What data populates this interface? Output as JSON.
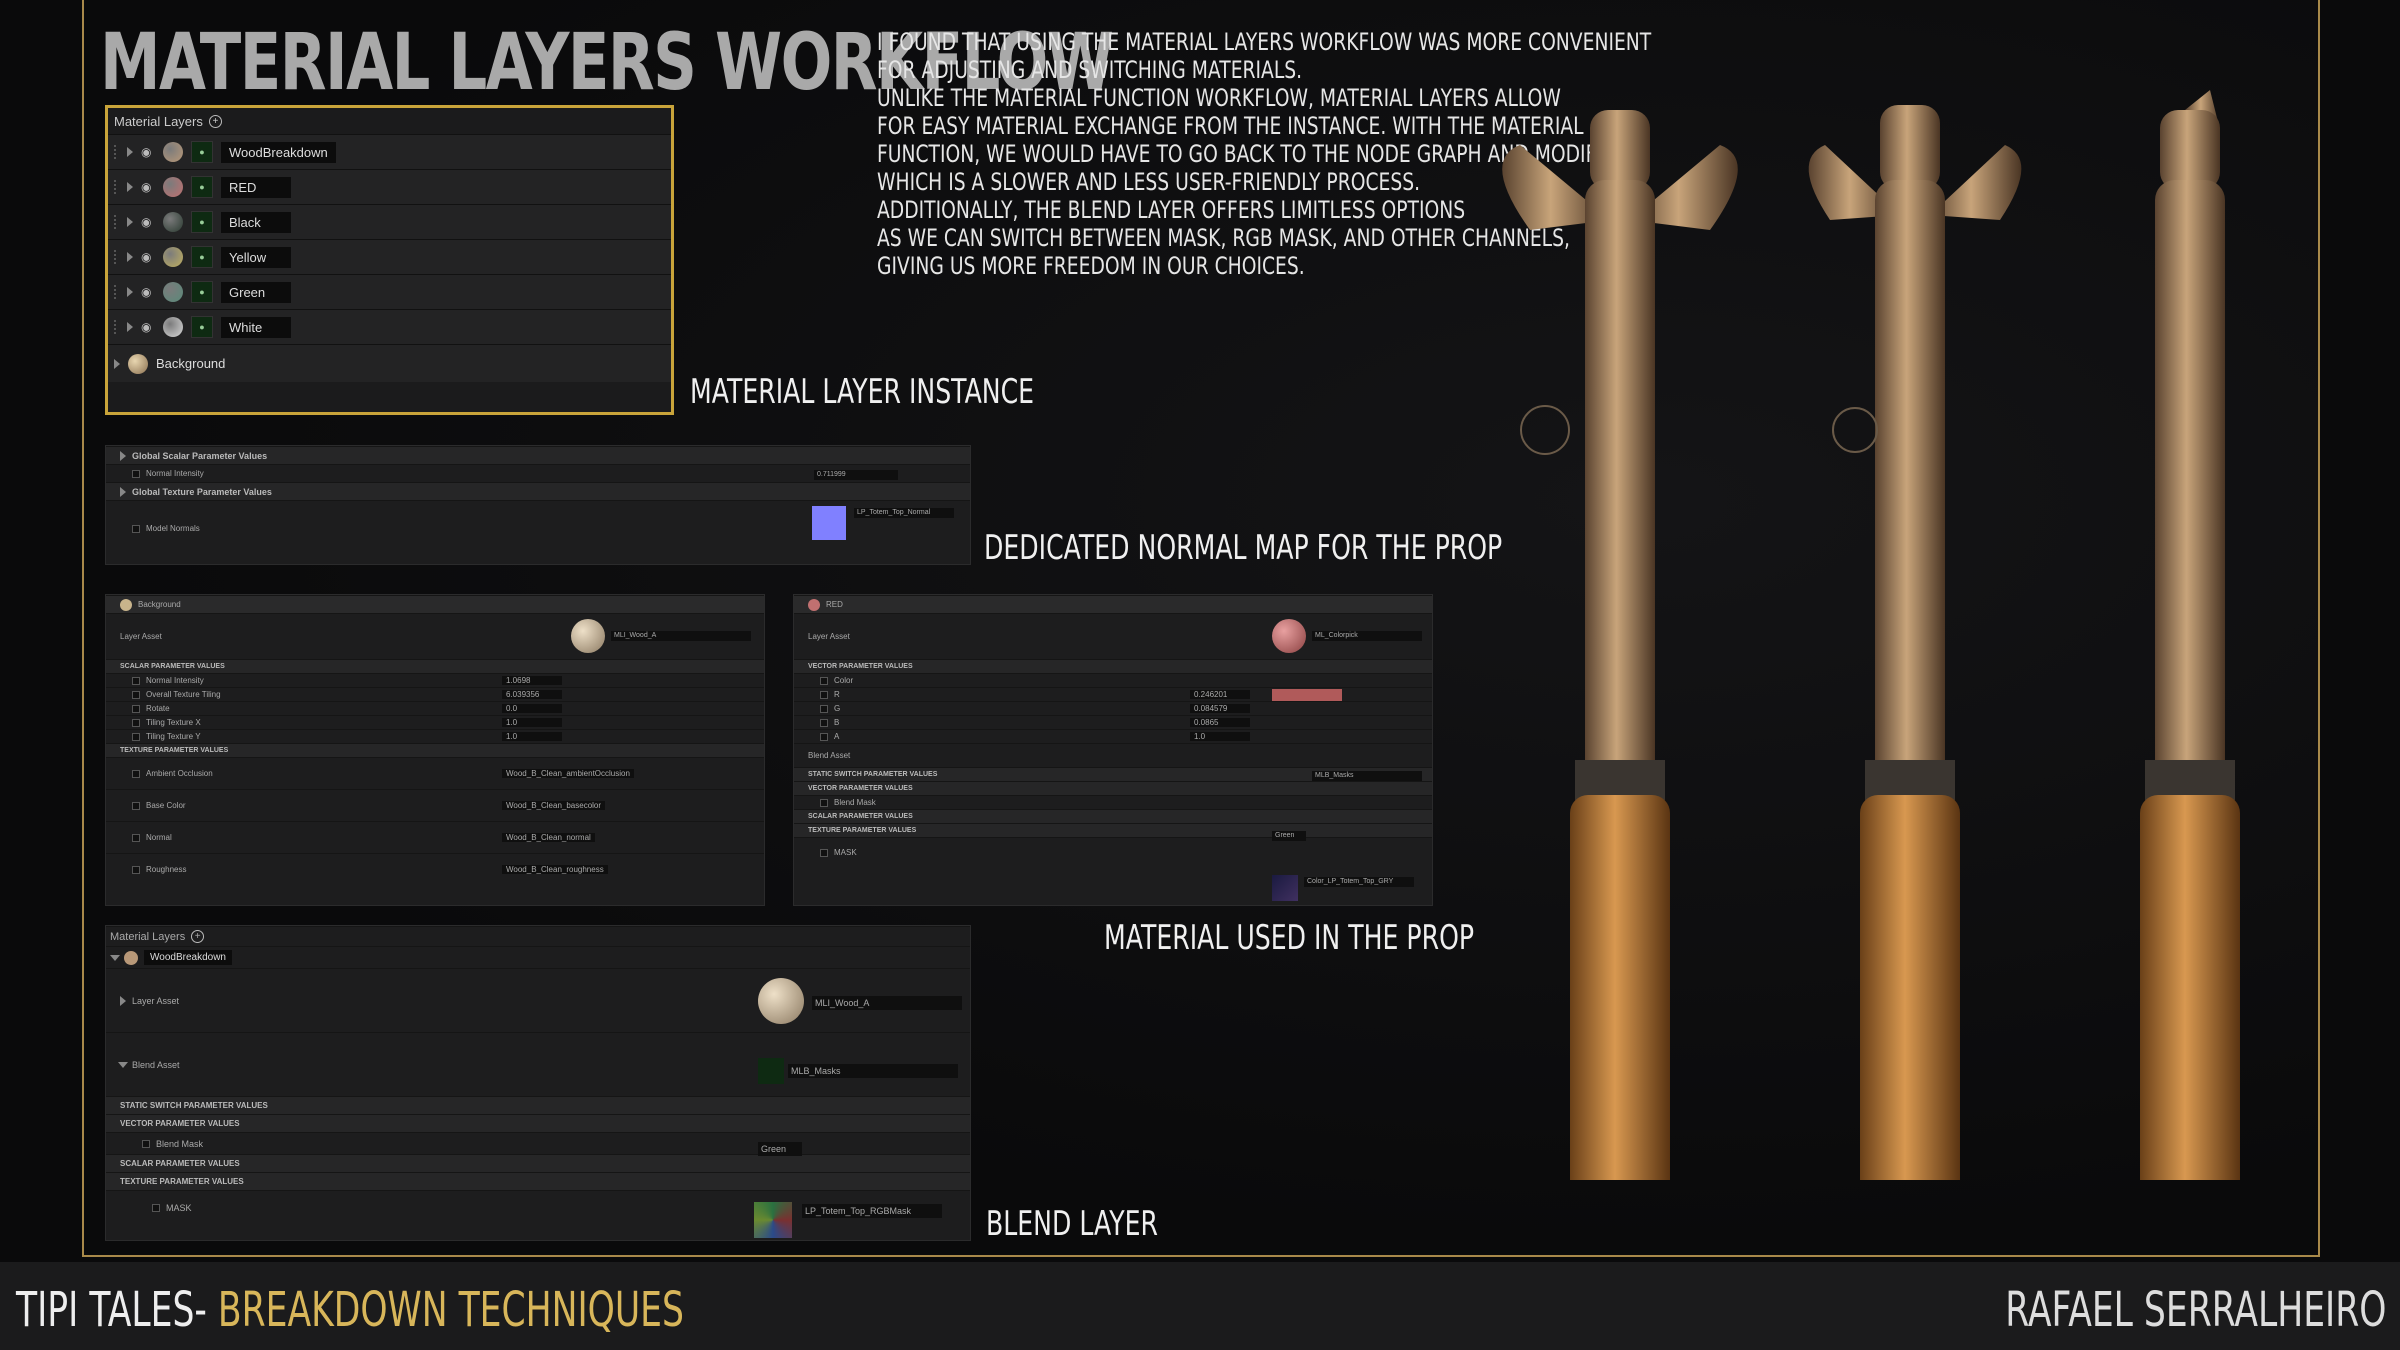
{
  "title": "MATERIAL LAYERS WORKFLOW",
  "description": [
    "I found that using the material layers workflow was more convenient",
    "for adjusting and switching materials.",
    "Unlike the material function workflow, material layers allow",
    "for easy material exchange from the instance. With the material",
    "function, we would have to go back to the node graph and modify it,",
    "which is a slower and less user-friendly process.",
    "Additionally, the blend layer offers limitless options",
    "as we can switch between mask, RGB mask, and other channels,",
    "giving us more freedom in our choices."
  ],
  "captions": {
    "instance": "MATERIAL LAYER INSTANCE",
    "normal": "DEDICATED NORMAL MAP FOR THE PROP",
    "used": "MATERIAL USED IN THE PROP",
    "blend": "BLEND LAYER"
  },
  "material_layers": {
    "header": "Material Layers",
    "layers": [
      {
        "name": "WoodBreakdown",
        "color": "#b89878"
      },
      {
        "name": "RED",
        "color": "#c07070"
      },
      {
        "name": "Black",
        "color": "#2a3a30"
      },
      {
        "name": "Yellow",
        "color": "#c0b060"
      },
      {
        "name": "Green",
        "color": "#5a8a7a"
      },
      {
        "name": "White",
        "color": "#d8d8d8"
      }
    ],
    "background": "Background"
  },
  "global_params": {
    "scalar_header": "Global Scalar Parameter Values",
    "normal_intensity": "Normal Intensity",
    "normal_intensity_value": "0.711999",
    "texture_header": "Global Texture Parameter Values",
    "model_normals": "Model Normals",
    "texture_name": "LP_Totem_Top_Normal"
  },
  "background_panel": {
    "header": "Background",
    "layer_asset": "Layer Asset",
    "asset_name": "MLI_Wood_A",
    "scalar_header": "SCALAR PARAMETER VALUES",
    "scalar_rows": [
      {
        "label": "Normal Intensity",
        "value": "1.0698"
      },
      {
        "label": "Overall Texture Tiling",
        "value": "6.039356"
      },
      {
        "label": "Rotate",
        "value": "0.0"
      },
      {
        "label": "Tiling Texture X",
        "value": "1.0"
      },
      {
        "label": "Tiling Texture Y",
        "value": "1.0"
      }
    ],
    "texture_header": "TEXTURE PARAMETER VALUES",
    "texture_rows": [
      {
        "label": "Ambient Occlusion",
        "tex": "Wood_B_Clean_ambientOcclusion"
      },
      {
        "label": "Base Color",
        "tex": "Wood_B_Clean_basecolor"
      },
      {
        "label": "Normal",
        "tex": "Wood_B_Clean_normal"
      },
      {
        "label": "Roughness",
        "tex": "Wood_B_Clean_roughness"
      }
    ]
  },
  "red_panel": {
    "header": "RED",
    "layer_asset": "Layer Asset",
    "asset_name": "ML_Colorpick",
    "vector_header": "VECTOR PARAMETER VALUES",
    "color_label": "Color",
    "channels": [
      {
        "label": "R",
        "value": "0.246201"
      },
      {
        "label": "G",
        "value": "0.084579"
      },
      {
        "label": "B",
        "value": "0.0865"
      },
      {
        "label": "A",
        "value": "1.0"
      }
    ],
    "blend_asset": "Blend Asset",
    "blend_name": "MLB_Masks",
    "static_header": "STATIC SWITCH PARAMETER VALUES",
    "vector_header2": "VECTOR PARAMETER VALUES",
    "blend_mask": "Blend Mask",
    "blend_mask_value": "Green",
    "scalar_header": "SCALAR PARAMETER VALUES",
    "texture_header": "TEXTURE PARAMETER VALUES",
    "mask_label": "MASK",
    "mask_tex": "Color_LP_Totem_Top_GRY"
  },
  "blend_panel": {
    "header": "Material Layers",
    "layer_name": "WoodBreakdown",
    "layer_asset": "Layer Asset",
    "asset_name": "MLI_Wood_A",
    "blend_asset": "Blend Asset",
    "blend_name": "MLB_Masks",
    "static_header": "STATIC SWITCH PARAMETER VALUES",
    "vector_header": "VECTOR PARAMETER VALUES",
    "blend_mask": "Blend Mask",
    "blend_mask_value": "Green",
    "scalar_header": "SCALAR PARAMETER VALUES",
    "texture_header": "TEXTURE PARAMETER VALUES",
    "mask_label": "MASK",
    "mask_tex": "LP_Totem_Top_RGBMask"
  },
  "footer": {
    "left_prefix": "TIPI TALES- ",
    "left_accent": "BREAKDOWN TECHNIQUES",
    "right": "RAFAEL SERRALHEIRO"
  },
  "colors": {
    "accent": "#d8b65a",
    "frame": "#a8894a",
    "highlight": "#c9a43a"
  }
}
